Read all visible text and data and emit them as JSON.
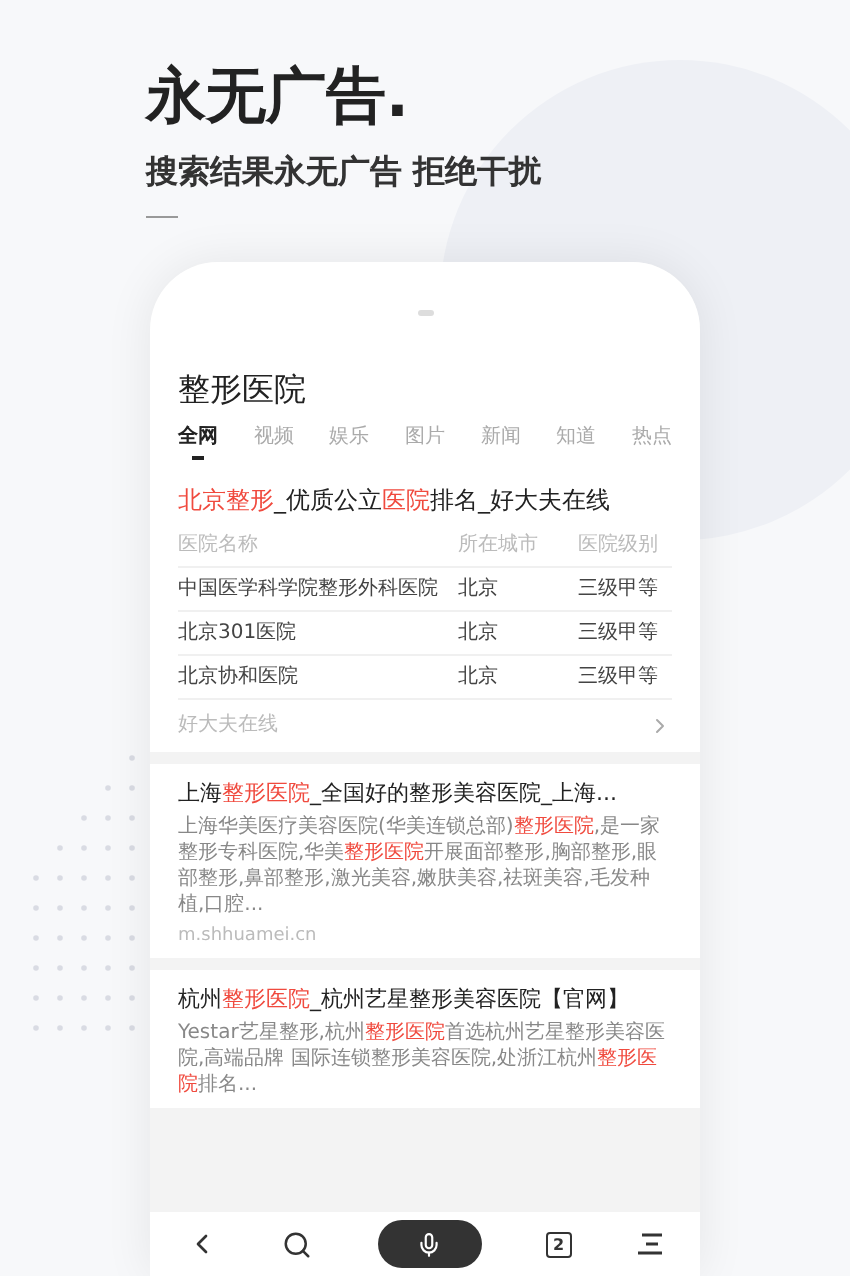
{
  "headline": "永无广告.",
  "subheadline": "搜索结果永无广告 拒绝干扰",
  "query": "整形医院",
  "tabs": [
    {
      "label": "全网",
      "selected": true
    },
    {
      "label": "视频",
      "selected": false
    },
    {
      "label": "娱乐",
      "selected": false
    },
    {
      "label": "图片",
      "selected": false
    },
    {
      "label": "新闻",
      "selected": false
    },
    {
      "label": "知道",
      "selected": false
    },
    {
      "label": "热点",
      "selected": false
    }
  ],
  "results": [
    {
      "kind": "table",
      "title": [
        {
          "text": "北京整形",
          "highlight": true
        },
        {
          "text": "_优质公立",
          "highlight": false
        },
        {
          "text": "医院",
          "highlight": true
        },
        {
          "text": "排名_好大夫在线",
          "highlight": false
        }
      ],
      "columns": [
        "医院名称",
        "所在城市",
        "医院级别"
      ],
      "rows": [
        [
          "中国医学科学院整形外科医院",
          "北京",
          "三级甲等"
        ],
        [
          "北京301医院",
          "北京",
          "三级甲等"
        ],
        [
          "北京协和医院",
          "北京",
          "三级甲等"
        ]
      ],
      "footer": "好大夫在线"
    },
    {
      "kind": "snippet",
      "title": [
        {
          "text": "上海",
          "highlight": false
        },
        {
          "text": "整形医院",
          "highlight": true
        },
        {
          "text": "_全国好的整形美容医院_上海...",
          "highlight": false
        }
      ],
      "snippet": [
        {
          "text": "上海华美医疗美容医院(华美连锁总部)",
          "highlight": false
        },
        {
          "text": "整形医院",
          "highlight": true
        },
        {
          "text": ",是一家整形专科医院,华美",
          "highlight": false
        },
        {
          "text": "整形医院",
          "highlight": true
        },
        {
          "text": "开展面部整形,胸部整形,眼部整形,鼻部整形,激光美容,嫩肤美容,祛斑美容,毛发种植,口腔...",
          "highlight": false
        }
      ],
      "url": "m.shhuamei.cn"
    },
    {
      "kind": "snippet",
      "title": [
        {
          "text": "杭州",
          "highlight": false
        },
        {
          "text": "整形医院",
          "highlight": true
        },
        {
          "text": "_杭州艺星整形美容医院【官网】",
          "highlight": false
        }
      ],
      "snippet": [
        {
          "text": "Yestar艺星整形,杭州",
          "highlight": false
        },
        {
          "text": "整形医院",
          "highlight": true
        },
        {
          "text": "首选杭州艺星整形美容医院,高端品牌 国际连锁整形美容医院,处浙江杭州",
          "highlight": false
        },
        {
          "text": "整形医院",
          "highlight": true
        },
        {
          "text": "排名...",
          "highlight": false
        }
      ]
    }
  ],
  "bottom_nav": {
    "tab_count": "2"
  }
}
